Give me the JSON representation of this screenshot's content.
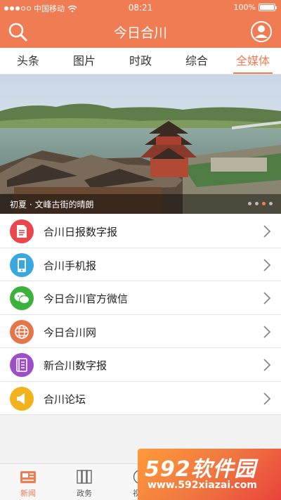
{
  "status_bar": {
    "carrier": "中国移动",
    "time": "08:21",
    "battery": "100%"
  },
  "header": {
    "title": "今日合川"
  },
  "tabs": [
    {
      "label": "头条",
      "active": false
    },
    {
      "label": "图片",
      "active": false
    },
    {
      "label": "时政",
      "active": false
    },
    {
      "label": "综合",
      "active": false
    },
    {
      "label": "全媒体",
      "active": true
    }
  ],
  "banner": {
    "caption": "初夏 · 文峰古街的晴朗",
    "page_count": 4,
    "current_page": 3
  },
  "list": [
    {
      "label": "合川日报数字报",
      "icon": "newspaper-icon",
      "color": "#e8474e"
    },
    {
      "label": "合川手机报",
      "icon": "phone-icon",
      "color": "#3aa8e0"
    },
    {
      "label": "今日合川官方微信",
      "icon": "wechat-icon",
      "color": "#3cb23c"
    },
    {
      "label": "今日合川网",
      "icon": "globe-icon",
      "color": "#e8744a"
    },
    {
      "label": "新合川数字报",
      "icon": "book-icon",
      "color": "#9b4fc9"
    },
    {
      "label": "合川论坛",
      "icon": "speaker-icon",
      "color": "#f2b21c"
    }
  ],
  "bottom_nav": [
    {
      "label": "新闻",
      "icon": "news-icon",
      "active": true
    },
    {
      "label": "政务",
      "icon": "government-icon",
      "active": false
    },
    {
      "label": "视频",
      "icon": "video-icon",
      "active": false
    }
  ],
  "watermark": {
    "brand": "592软件园",
    "url": "www.592xiazai.com"
  },
  "colors": {
    "accent": "#f07c54"
  }
}
